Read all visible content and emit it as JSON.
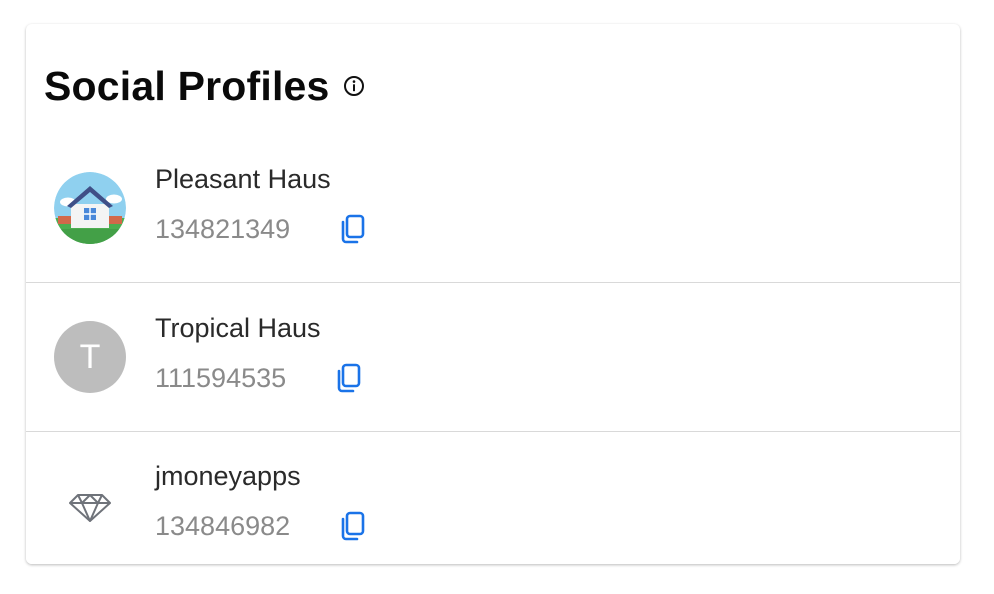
{
  "panel": {
    "title": "Social Profiles",
    "info_icon": "info-circle-icon"
  },
  "profiles": [
    {
      "name": "Pleasant Haus",
      "id": "134821349",
      "avatar": "house-illustration",
      "copy_icon": "copy-icon"
    },
    {
      "name": "Tropical Haus",
      "id": "111594535",
      "avatar_letter": "T",
      "copy_icon": "copy-icon"
    },
    {
      "name": "jmoneyapps",
      "id": "134846982",
      "avatar": "diamond-icon",
      "copy_icon": "copy-icon"
    }
  ],
  "colors": {
    "accent": "#1a73e8",
    "avatar_placeholder": "#bdbdbd",
    "divider": "#d9d9d9",
    "id_text": "#8a8a8a"
  }
}
